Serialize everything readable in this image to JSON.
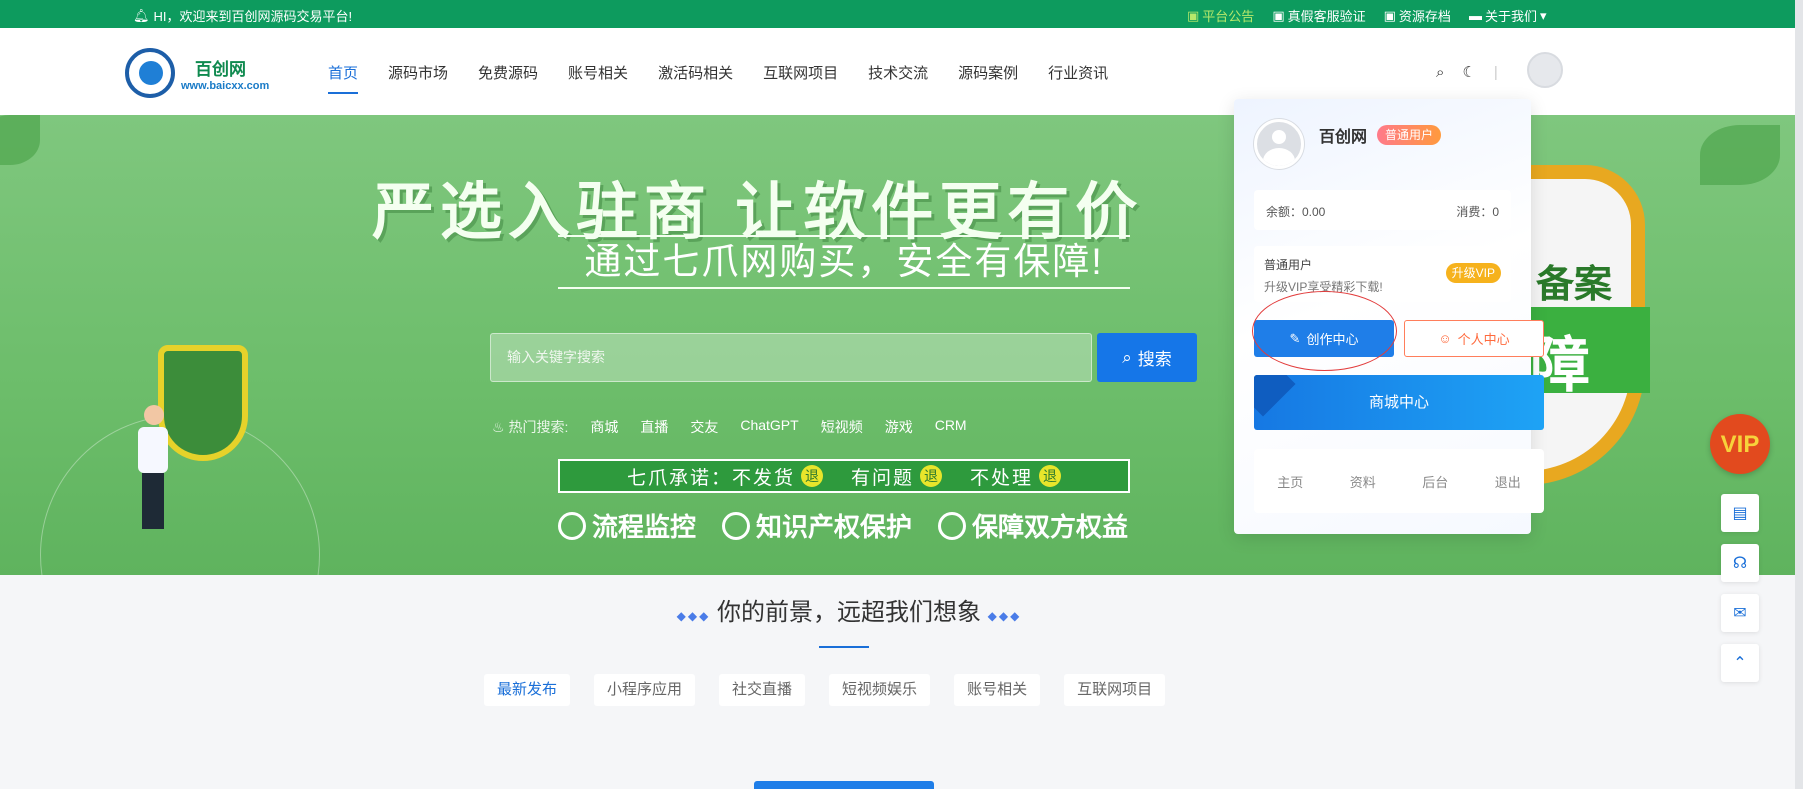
{
  "topbar": {
    "welcome": "HI，欢迎来到百创网源码交易平台!",
    "links": [
      "平台公告",
      "真假客服验证",
      "资源存档",
      "关于我们"
    ]
  },
  "logo": {
    "name": "百创网",
    "url": "www.baicxx.com"
  },
  "nav": [
    "首页",
    "源码市场",
    "免费源码",
    "账号相关",
    "激活码相关",
    "互联网项目",
    "技术交流",
    "源码案例",
    "行业资讯"
  ],
  "banner": {
    "headline": "严选入驻商 让软件更有价",
    "subline": "通过七爪网购买，安全有保障!",
    "search_placeholder": "输入关键字搜索",
    "search_button": "搜索",
    "hot_label": "热门搜索:",
    "hot_items": [
      "商城",
      "直播",
      "交友",
      "ChatGPT",
      "短视频",
      "游戏",
      "CRM"
    ],
    "promise": [
      "七爪承诺：不发货",
      "有问题",
      "不处理"
    ],
    "promise_badge": "退",
    "features": [
      "流程监控",
      "知识产权保护",
      "保障双方权益"
    ],
    "shield_text_1": "备案",
    "shield_text_2": "障"
  },
  "dropdown": {
    "name": "百创网",
    "badge": "普通用户",
    "balance": "余额：0.00",
    "spend": "消费：0",
    "level": "普通用户",
    "upgrade_tip": "升级VIP享受精彩下载!",
    "upgrade_button": "升级VIP",
    "create_button": "创作中心",
    "personal_button": "个人中心",
    "mall_button": "商城中心",
    "footer": [
      "主页",
      "资料",
      "后台",
      "退出"
    ]
  },
  "section": {
    "title": "你的前景，远超我们想象",
    "tabs": [
      "最新发布",
      "小程序应用",
      "社交直播",
      "短视频娱乐",
      "账号相关",
      "互联网项目"
    ]
  },
  "floating": {
    "vip": "VIP"
  },
  "colors": {
    "topbar": "#0d9b5e",
    "primary": "#1a6fd8",
    "banner": "#7fc77e",
    "accent_orange": "#ff6a3d"
  }
}
